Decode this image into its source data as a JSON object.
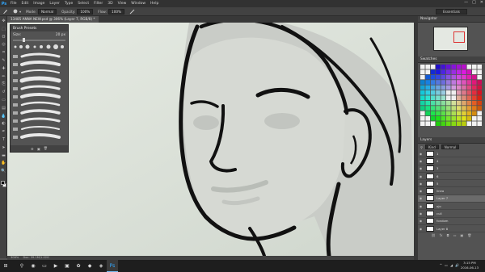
{
  "app": {
    "logo": "Ps",
    "window_controls": [
      "—",
      "□",
      "✕"
    ]
  },
  "menu": [
    "File",
    "Edit",
    "Image",
    "Layer",
    "Type",
    "Select",
    "Filter",
    "3D",
    "View",
    "Window",
    "Help"
  ],
  "options_bar": {
    "mode_label": "Mode:",
    "mode_value": "Normal",
    "opacity_label": "Opacity:",
    "opacity_value": "100%",
    "flow_label": "Flow:",
    "flow_value": "100%",
    "workspace": "Essentials"
  },
  "document": {
    "tab_title": "13485 ANNA NEW.psd @ 306% (Layer 7, RGB/8) *"
  },
  "tools": [
    "move-icon",
    "marquee-icon",
    "lasso-icon",
    "quick-select-icon",
    "crop-icon",
    "eyedropper-icon",
    "healing-icon",
    "brush-icon",
    "stamp-icon",
    "history-brush-icon",
    "eraser-icon",
    "gradient-icon",
    "blur-icon",
    "dodge-icon",
    "pen-icon",
    "type-icon",
    "path-select-icon",
    "shape-icon",
    "hand-icon",
    "zoom-icon"
  ],
  "tool_glyphs": [
    "✥",
    "⬚",
    "ʘ",
    "◎",
    "⌗",
    "✎",
    "✚",
    "✏",
    "⎘",
    "↺",
    "▭",
    "▤",
    "💧",
    "◐",
    "✒",
    "T",
    "➤",
    "▬",
    "✋",
    "🔍"
  ],
  "brush_panel": {
    "title": "Brush Presets",
    "size_label": "Size:",
    "size_value": "20 px"
  },
  "statusbar": {
    "zoom": "306%",
    "doc_size": "Doc: 39.1M/1.02G"
  },
  "right_panels": {
    "navigator_title": "Navigator",
    "swatches_title": "Swatches",
    "layers_title": "Layers",
    "layers_kind": "Kind",
    "layers_blend": "Normal",
    "layers": [
      {
        "name": "1"
      },
      {
        "name": "4"
      },
      {
        "name": "3"
      },
      {
        "name": "6"
      },
      {
        "name": "5"
      },
      {
        "name": "linea"
      },
      {
        "name": "Layer 7",
        "active": true
      },
      {
        "name": "ojo"
      },
      {
        "name": "cull"
      },
      {
        "name": "fondom"
      },
      {
        "name": "Layer 8"
      }
    ]
  },
  "colors": {
    "accent": "#31a8ff",
    "ui_dark": "#323232",
    "panel": "#535353",
    "canvas_bg": "#dde3dc",
    "skin": "#d3d7d0",
    "line": "#111111"
  },
  "taskbar": {
    "icons": [
      "windows-icon",
      "search-icon",
      "chrome-icon",
      "explorer-icon",
      "media-icon",
      "folder-icon",
      "settings-icon",
      "app-icon",
      "store-icon",
      "photoshop-icon"
    ],
    "glyphs": [
      "⊞",
      "⚲",
      "◉",
      "▭",
      "▶",
      "▣",
      "✿",
      "◆",
      "◈",
      "Ps"
    ],
    "tray_icons": [
      "^",
      "▭",
      "◢",
      "🔊"
    ],
    "time": "3:15 PM",
    "date": "2016-06-13"
  }
}
